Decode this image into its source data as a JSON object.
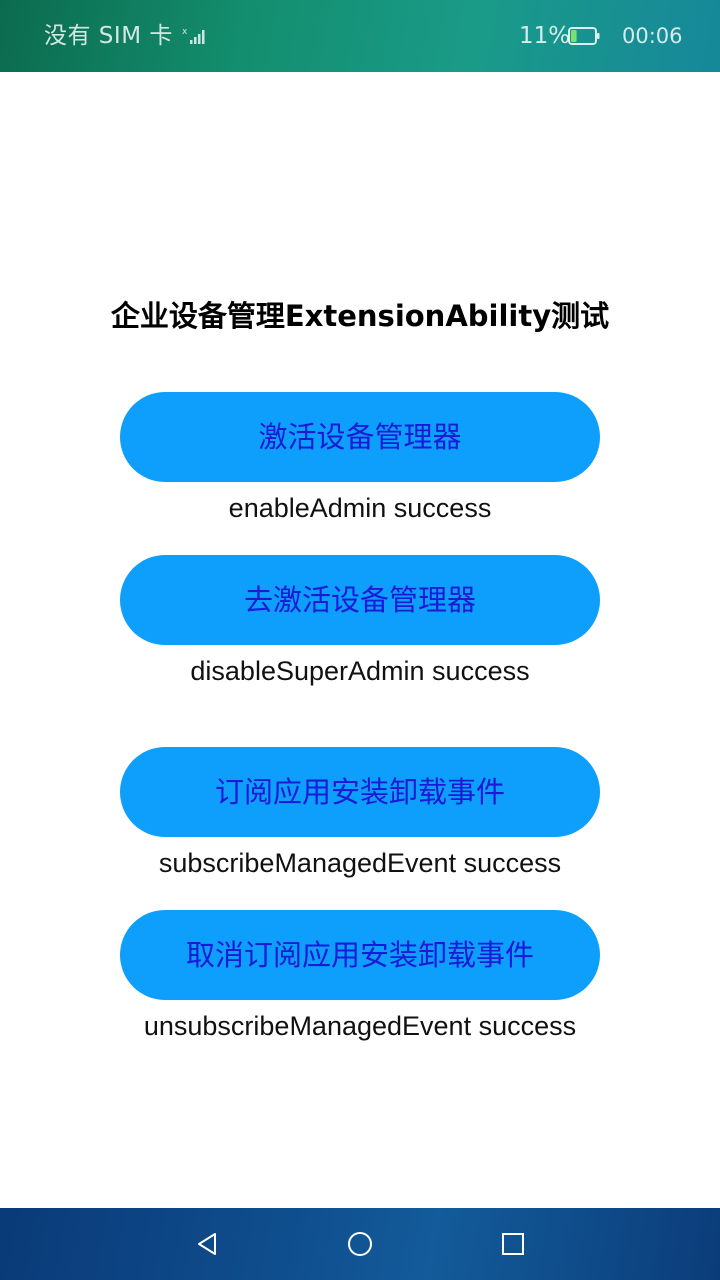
{
  "status_bar": {
    "carrier": "没有 SIM 卡",
    "battery_percent": "11%",
    "battery_level": 0.11,
    "time": "00:06",
    "icons": [
      "signal-icon",
      "battery-icon"
    ]
  },
  "page": {
    "title": "企业设备管理ExtensionAbility测试"
  },
  "actions": [
    {
      "label": "激活设备管理器",
      "result": "enableAdmin success"
    },
    {
      "label": "去激活设备管理器",
      "result": "disableSuperAdmin success"
    },
    {
      "label": "订阅应用安装卸载事件",
      "result": "subscribeManagedEvent success"
    },
    {
      "label": "取消订阅应用安装卸载事件",
      "result": "unsubscribeManagedEvent success"
    }
  ],
  "nav_bar": {
    "icons": [
      "back-icon",
      "home-icon",
      "recents-icon"
    ]
  },
  "colors": {
    "button_bg": "#0d9ffb",
    "button_text": "#1a1ad8",
    "status_bar": "#138f6f",
    "nav_bar": "#0f4e8e"
  }
}
